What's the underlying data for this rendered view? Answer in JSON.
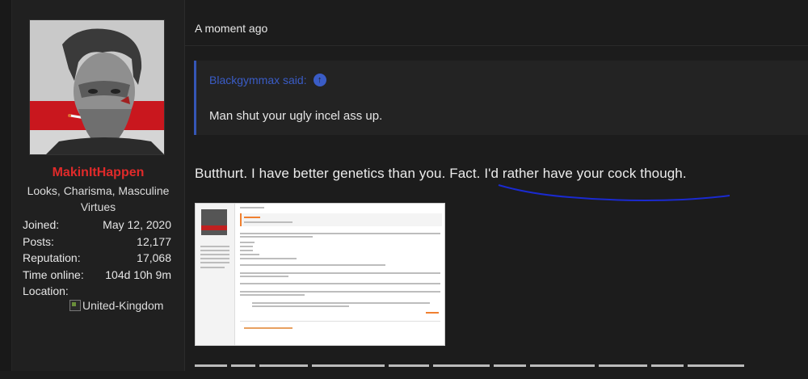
{
  "user": {
    "username": "MakinItHappen",
    "title": "Looks, Charisma, Masculine Virtues",
    "stats": [
      {
        "key": "Joined:",
        "value": "May 12, 2020"
      },
      {
        "key": "Posts:",
        "value": "12,177"
      },
      {
        "key": "Reputation:",
        "value": "17,068"
      },
      {
        "key": "Time online:",
        "value": "104d 10h 9m"
      },
      {
        "key": "Location:",
        "value": ""
      }
    ],
    "location_flag_alt": "United-Kingdom"
  },
  "post": {
    "timestamp": "A moment ago",
    "quote": {
      "author_line": "Blackgymmax said:",
      "body": "Man shut your ugly incel ass up."
    },
    "text": "Butthurt. I have better genetics than you. Fact. I'd rather have your cock though."
  },
  "colors": {
    "username": "#e02a2a",
    "quote_accent": "#3a5cc6",
    "underline": "#1a2ad0",
    "background": "#1c1c1c"
  }
}
